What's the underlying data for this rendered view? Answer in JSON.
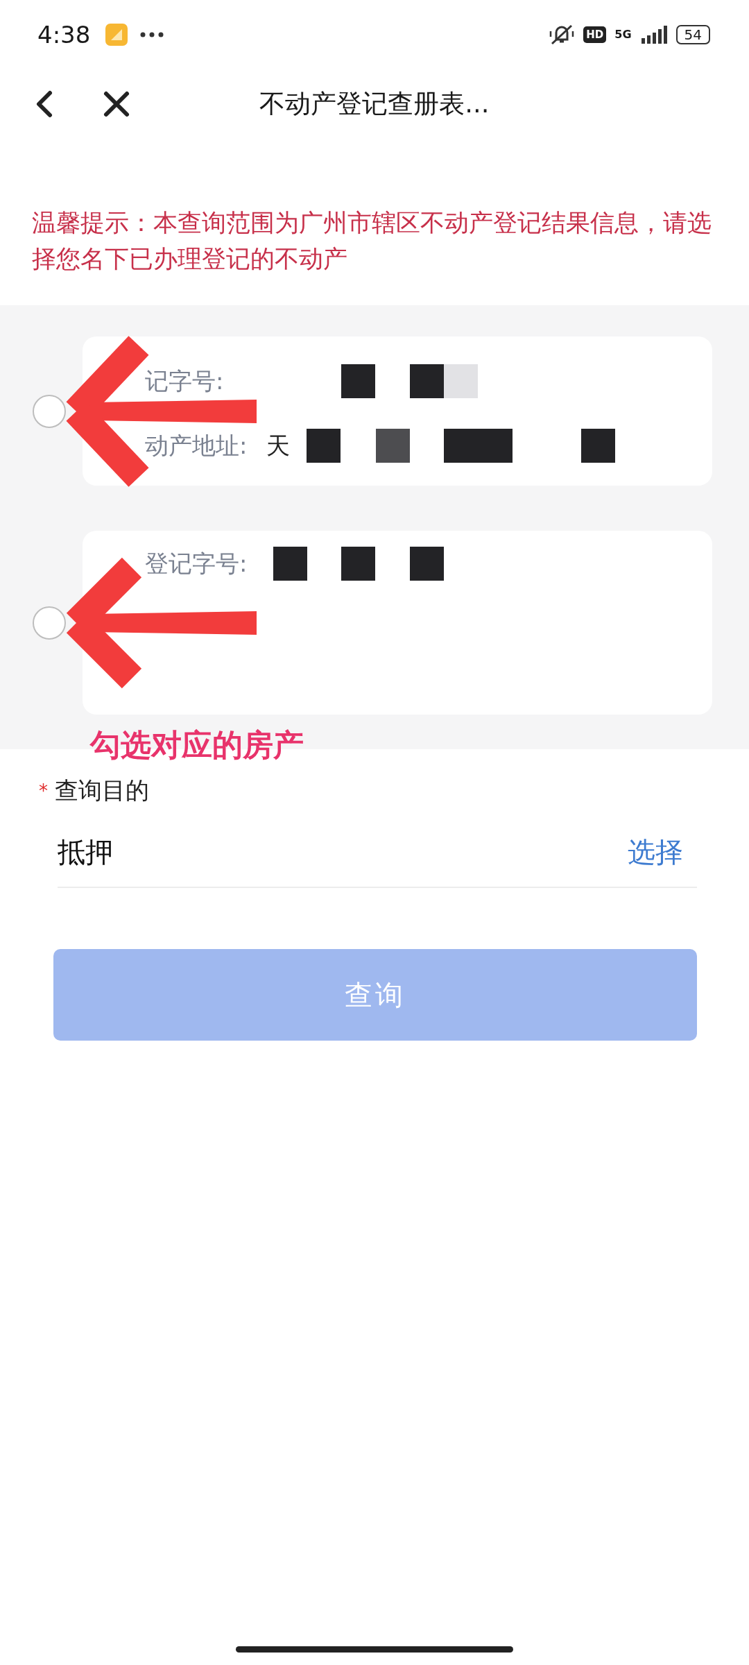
{
  "status_bar": {
    "time": "4:38",
    "network_badge": "HD",
    "network_type": "5G",
    "battery": "54"
  },
  "nav": {
    "title": "不动产登记查册表..."
  },
  "notice": {
    "text": "温馨提示：本查询范围为广州市辖区不动产登记结果信息，请选择您名下已办理登记的不动产"
  },
  "records": [
    {
      "selected": false,
      "rows": [
        {
          "kind": "number",
          "label": "记字号:"
        },
        {
          "kind": "address",
          "label": "动产地址:",
          "value": "天"
        }
      ]
    },
    {
      "selected": false,
      "rows": [
        {
          "kind": "number",
          "label": "登记字号:"
        }
      ]
    }
  ],
  "annotation": {
    "text": "勾选对应的房产"
  },
  "purpose": {
    "required_mark": "*",
    "label": "查询目的",
    "value": "抵押",
    "action": "选择"
  },
  "submit": {
    "label": "查询",
    "disabled": true
  }
}
